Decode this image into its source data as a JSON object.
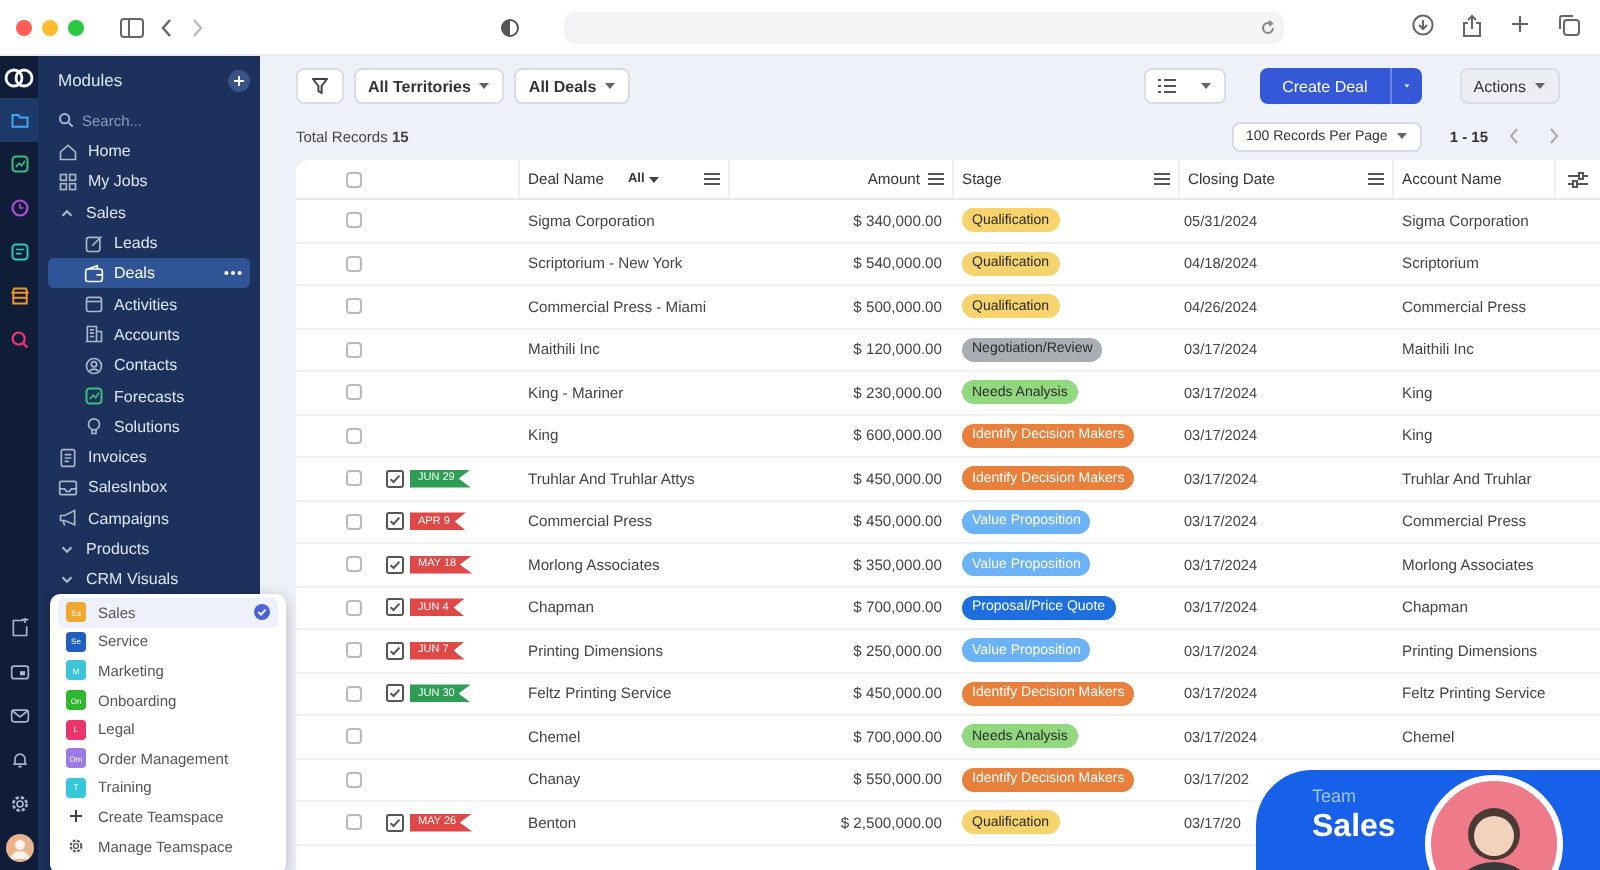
{
  "rail": {
    "top": [
      {
        "kind": "folder",
        "selected": true
      },
      {
        "kind": "chart",
        "selected": false
      },
      {
        "kind": "clock",
        "selected": false
      },
      {
        "kind": "note",
        "selected": false
      },
      {
        "kind": "store",
        "selected": false
      },
      {
        "kind": "search",
        "selected": false
      }
    ],
    "bottom": [
      {
        "kind": "compose"
      },
      {
        "kind": "photo"
      },
      {
        "kind": "mail"
      },
      {
        "kind": "bell"
      },
      {
        "kind": "gear"
      },
      {
        "kind": "avatar"
      }
    ]
  },
  "sidebar": {
    "title": "Modules",
    "search": {
      "placeholder": "Search..."
    },
    "items": [
      {
        "label": "Home",
        "selected": false
      },
      {
        "label": "My Jobs",
        "selected": false
      },
      {
        "label": "Sales",
        "selected": false,
        "expanded": true,
        "children": [
          {
            "label": "Leads",
            "selected": false
          },
          {
            "label": "Deals",
            "selected": true
          },
          {
            "label": "Activities",
            "selected": false
          },
          {
            "label": "Accounts",
            "selected": false
          },
          {
            "label": "Contacts",
            "selected": false
          },
          {
            "label": "Forecasts",
            "selected": false
          },
          {
            "label": "Solutions",
            "selected": false
          }
        ]
      },
      {
        "label": "Invoices",
        "selected": false
      },
      {
        "label": "SalesInbox",
        "selected": false
      },
      {
        "label": "Campaigns",
        "selected": false
      },
      {
        "label": "Products",
        "selected": false,
        "expanded": false
      },
      {
        "label": "CRM Visuals",
        "selected": false,
        "expanded": false
      }
    ]
  },
  "teamspaces": {
    "items": [
      {
        "label": "Sales",
        "badge": "Sa",
        "color": "#f0a830",
        "selected": true
      },
      {
        "label": "Service",
        "badge": "Se",
        "color": "#1f5fbf",
        "selected": false
      },
      {
        "label": "Marketing",
        "badge": "M",
        "color": "#3cc4d8",
        "selected": false
      },
      {
        "label": "Onboarding",
        "badge": "On",
        "color": "#2fb82f",
        "selected": false
      },
      {
        "label": "Legal",
        "badge": "L",
        "color": "#e8356a",
        "selected": false
      },
      {
        "label": "Order Management",
        "badge": "Om",
        "color": "#9b7be8",
        "selected": false
      },
      {
        "label": "Training",
        "badge": "T",
        "color": "#35c8d8",
        "selected": false
      }
    ],
    "actions": [
      {
        "label": "Create Teamspace",
        "kind": "create"
      },
      {
        "label": "Manage Teamspace",
        "kind": "manage"
      }
    ]
  },
  "toolbar": {
    "filters": [
      "All Territories",
      "All Deals"
    ],
    "primary": "Create Deal",
    "actions": "Actions"
  },
  "summary": {
    "total": "Total Records **15**",
    "per_page": "100 Records Per Page",
    "range": "1 - 15"
  },
  "table": {
    "columns": [
      {
        "label": "Deal Name",
        "filter": "All",
        "menu": true
      },
      {
        "label": "Amount",
        "menu": true
      },
      {
        "label": "Stage",
        "menu": true
      },
      {
        "label": "Closing Date",
        "menu": true
      },
      {
        "label": "Account Name",
        "menu": false
      }
    ],
    "header_checked": false,
    "rows": [
      {
        "checked": false,
        "deal": "Sigma Corporation",
        "amount": "$ 340,000.00",
        "stage": {
          "label": "Qualification",
          "color": "#f6d36c"
        },
        "closing": "05/31/2024",
        "account": "Sigma Corporation"
      },
      {
        "checked": false,
        "deal": "Scriptorium - New York",
        "amount": "$ 540,000.00",
        "stage": {
          "label": "Qualification",
          "color": "#f6d36c"
        },
        "closing": "04/18/2024",
        "account": "Scriptorium"
      },
      {
        "checked": false,
        "deal": "Commercial Press - Miami",
        "amount": "$ 500,000.00",
        "stage": {
          "label": "Qualification",
          "color": "#f6d36c"
        },
        "closing": "04/26/2024",
        "account": "Commercial Press"
      },
      {
        "checked": false,
        "deal": "Maithili Inc",
        "amount": "$ 120,000.00",
        "stage": {
          "label": "Negotiation/Review",
          "color": "#a9adb4"
        },
        "closing": "03/17/2024",
        "account": "Maithili Inc"
      },
      {
        "checked": false,
        "deal": "King - Mariner",
        "amount": "$ 230,000.00",
        "stage": {
          "label": "Needs Analysis",
          "color": "#92d87f"
        },
        "closing": "03/17/2024",
        "account": "King"
      },
      {
        "checked": false,
        "deal": "King",
        "amount": "$ 600,000.00",
        "stage": {
          "label": "Identify Decision Makers",
          "color": "#e8803c"
        },
        "closing": "03/17/2024",
        "account": "King"
      },
      {
        "checked": false,
        "task": {
          "label": "JUN 29",
          "color": "#2e9e55"
        },
        "deal": "Truhlar And Truhlar Attys",
        "amount": "$ 450,000.00",
        "stage": {
          "label": "Identify Decision Makers",
          "color": "#e8803c"
        },
        "closing": "03/17/2024",
        "account": "Truhlar And Truhlar"
      },
      {
        "checked": false,
        "task": {
          "label": "APR 9",
          "color": "#e04848"
        },
        "deal": "Commercial Press",
        "amount": "$ 450,000.00",
        "stage": {
          "label": "Value Proposition",
          "color": "#6cb2f6"
        },
        "closing": "03/17/2024",
        "account": "Commercial Press"
      },
      {
        "checked": false,
        "task": {
          "label": "MAY 18",
          "color": "#e04848"
        },
        "deal": "Morlong Associates",
        "amount": "$ 350,000.00",
        "stage": {
          "label": "Value Proposition",
          "color": "#6cb2f6"
        },
        "closing": "03/17/2024",
        "account": "Morlong Associates"
      },
      {
        "checked": false,
        "task": {
          "label": "JUN 4",
          "color": "#e04848"
        },
        "deal": "Chapman",
        "amount": "$ 700,000.00",
        "stage": {
          "label": "Proposal/Price Quote",
          "color": "#1d6fe0"
        },
        "closing": "03/17/2024",
        "account": "Chapman"
      },
      {
        "checked": false,
        "task": {
          "label": "JUN 7",
          "color": "#e04848"
        },
        "deal": "Printing Dimensions",
        "amount": "$ 250,000.00",
        "stage": {
          "label": "Value Proposition",
          "color": "#6cb2f6"
        },
        "closing": "03/17/2024",
        "account": "Printing Dimensions"
      },
      {
        "checked": false,
        "task": {
          "label": "JUN 30",
          "color": "#2e9e55"
        },
        "deal": "Feltz Printing Service",
        "amount": "$ 450,000.00",
        "stage": {
          "label": "Identify Decision Makers",
          "color": "#e8803c"
        },
        "closing": "03/17/2024",
        "account": "Feltz Printing Service"
      },
      {
        "checked": false,
        "deal": "Chemel",
        "amount": "$ 700,000.00",
        "stage": {
          "label": "Needs Analysis",
          "color": "#92d87f"
        },
        "closing": "03/17/2024",
        "account": "Chemel"
      },
      {
        "checked": false,
        "deal": "Chanay",
        "amount": "$ 550,000.00",
        "stage": {
          "label": "Identify Decision Makers",
          "color": "#e8803c"
        },
        "closing": "03/17/202"
      },
      {
        "checked": false,
        "task": {
          "label": "MAY 26",
          "color": "#e04848"
        },
        "deal": "Benton",
        "amount": "$ 2,500,000.00",
        "stage": {
          "label": "Qualification",
          "color": "#f6d36c"
        },
        "closing": "03/17/20"
      }
    ]
  },
  "team_badge": {
    "caption": "Team",
    "name": "Sales"
  }
}
